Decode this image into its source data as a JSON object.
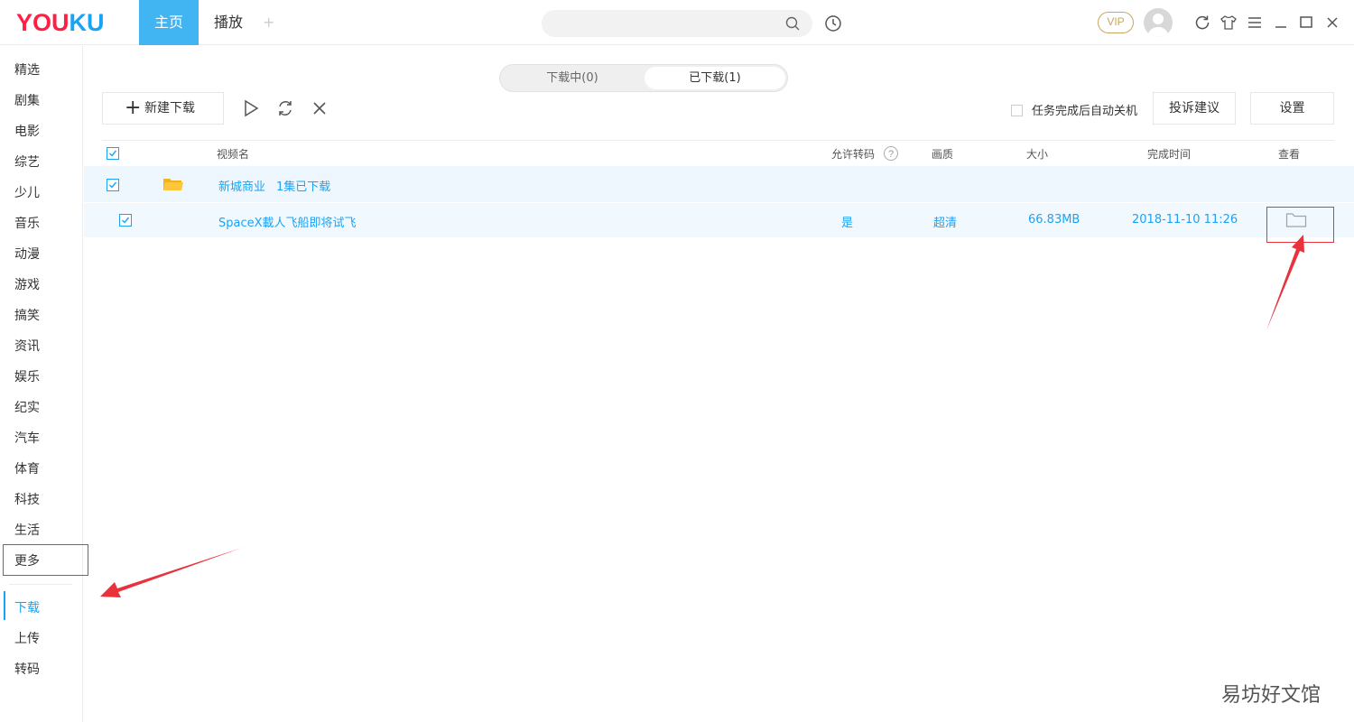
{
  "app": {
    "logo_you": "YOU",
    "logo_ku": "KU",
    "tabs": [
      {
        "label": "主页",
        "active": true
      },
      {
        "label": "播放",
        "active": false
      }
    ],
    "add_tab": "+",
    "search_placeholder": "",
    "vip_label": "VIP"
  },
  "sidebar": {
    "items": [
      "精选",
      "剧集",
      "电影",
      "综艺",
      "少儿",
      "音乐",
      "动漫",
      "游戏",
      "搞笑",
      "资讯",
      "娱乐",
      "纪实",
      "汽车",
      "体育",
      "科技",
      "生活",
      "更多"
    ],
    "bottom_items": [
      "下载",
      "上传",
      "转码"
    ],
    "active": "下载"
  },
  "downloads": {
    "tabs": {
      "downloading": "下载中(0)",
      "downloaded": "已下载(1)"
    },
    "active_tab": "downloaded",
    "new_download": "新建下载",
    "auto_shutdown": "任务完成后自动关机",
    "feedback": "投诉建议",
    "settings": "设置",
    "columns": {
      "name": "视频名",
      "transcode": "允许转码",
      "quality": "画质",
      "size": "大小",
      "finish_time": "完成时间",
      "view": "查看"
    },
    "group": {
      "title": "新城商业",
      "count": "1集已下载"
    },
    "item": {
      "name": "SpaceX載人飞船即将试飞",
      "transcode": "是",
      "quality": "超清",
      "size": "66.83MB",
      "finish_time": "2018-11-10 11:26"
    }
  },
  "watermark": "易坊好文馆",
  "colors": {
    "accent": "#1aa3f5",
    "tab_active": "#41b4f2",
    "annotation": "#e8323c",
    "logo_red": "#ff1f45"
  }
}
